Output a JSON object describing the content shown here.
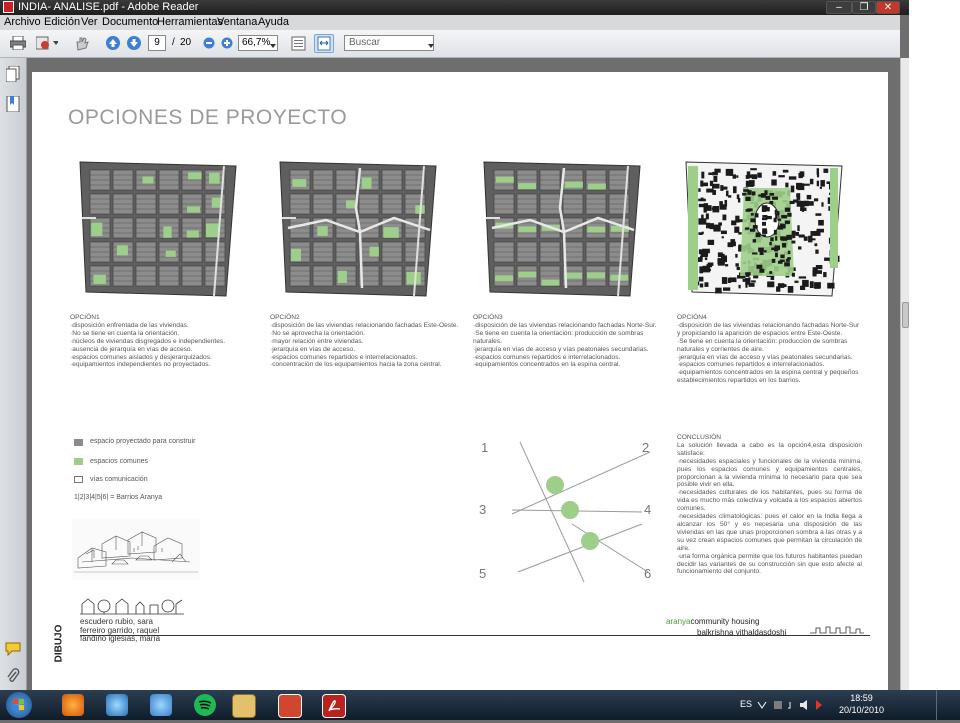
{
  "window": {
    "title": "INDIA- ANALISE.pdf - Adobe Reader",
    "controls": [
      "–",
      "❐",
      "✕"
    ]
  },
  "menu": [
    "Archivo",
    "Edición",
    "Ver",
    "Documento",
    "Herramientas",
    "Ventana",
    "Ayuda"
  ],
  "toolbar": {
    "current_page": "9",
    "page_separator": "/",
    "total_pages": "20",
    "zoom": "66,7%",
    "search_placeholder": "Buscar"
  },
  "document": {
    "title": "OPCIONES DE PROYECTO",
    "options": [
      {
        "text": "OPCIÓN1\n·disposición enfrentada de las viviendas.\n·No se tiene en cuenta la orientación.\n·núcleos de viviendas disgregados e independientes.\n·ausencia de jerarquía en vías de acceso.\n·espacios comunes aislados y desjerarquizados.\n·equipamientos independientes no proyectados."
      },
      {
        "text": "OPCIÓN2\n·disposición de las viviendas relacionando fachadas Este-Oeste.\n·No se aprovecha la orientación.\n·mayor relación entre viviendas.\n·jerarquía en vías de acceso.\n·espacios comunes repartidos e interrelacionados.\n·concentración de los equipamientos hacia la zona central."
      },
      {
        "text": "OPCIÓN3\n·disposición de las viviendas relacionando fachadas Norte-Sur.\n·Se tiene en cuenta la orientación: producción de sombras naturales.\n·jerarquía en vías de acceso y vías peatonales secundarias.\n·espacios comunes repartidos e interrelacionados.\n·equipamientos concentrados en la espina central."
      },
      {
        "text": "OPCIÓN4\n·disposición de las viviendas relacionando fachadas Norte-Sur y propiciando la aparición de espacios entre Este-Oeste.\n·Se tiene en cuenta la orientación: producción de sombras naturales y corrientes de aire.\n·jerarquía en vías de acceso y vías peatonales secundarias.\n·espacios comunes repartidos e interrelacionados.\n·equipamientos concentrados en la espina central y pequeños establecimientos repartidos en los barrios."
      }
    ],
    "legend": [
      {
        "label": "espacio proyectado para construir",
        "color": "#8c8c8c"
      },
      {
        "label": "espacios comunes",
        "color": "#9ecf8a"
      },
      {
        "label": "vías comunicación",
        "color": "#ffffff"
      }
    ],
    "barrios": "1|2|3|4|5|6| = Barrios Aranya",
    "conclusion": "CONCLUSIÓN\nLa solución llevada a cabo es la opción4,esta disposición satisface:\n·necesidades espaciales y funcionales de la vivienda mínima, pues los espacios comunes y equipamientos centrales, proporcionan a la vivienda mínima lo necesario para que sea posible vivir en ella.\n·necesidades culturales de los habitantes, pues su forma de vida es mucho más colectiva y volcada a los espacios abiertos comunes.\n·necesidades climatológicas: pues el calor en la India llega a alcanzar los 50° y es necesaria una disposición de las viviendas en las que unas proporcionen sombra a las otras y a su vez crean espacios comunes que permitan la circulación de aire.\n·una forma orgánica permite que los futuros habitantes puedan decidir las variantes de su construcción sin que esto afecte al funcionamiento del conjunto.",
    "diagram_numbers": [
      "1",
      "2",
      "3",
      "4",
      "5",
      "6"
    ],
    "dibujo_label": "DIBUJO",
    "authors": "escudero rubio, sara\nferreiro garrido, raquel\nfandiño iglesias, maría",
    "footer_brand_a": "aranya",
    "footer_brand_b": "community housing",
    "footer_architect": "balkrishna vithaldasdoshi"
  },
  "taskbar": {
    "language": "ES",
    "time": "18:59",
    "date": "20/10/2010"
  },
  "colors": {
    "accent_green": "#9ecf8a",
    "pdf_red": "#c8231f",
    "taskbar": "#1b2b3b"
  }
}
